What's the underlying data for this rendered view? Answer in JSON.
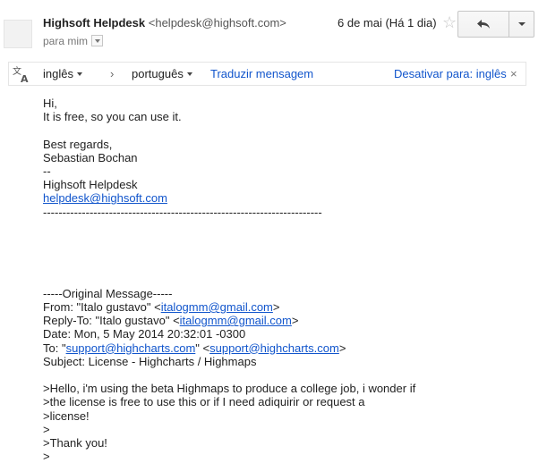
{
  "header": {
    "sender_name": "Highsoft Helpdesk",
    "sender_email": "<helpdesk@highsoft.com>",
    "recipient_label": "para mim",
    "date": "6 de mai (Há 1 dia)"
  },
  "translate_bar": {
    "source_language": "inglês",
    "arrow": "›",
    "target_language": "português",
    "translate_link": "Traduzir mensagem",
    "disable_link": "Desativar para: inglês",
    "close": "×"
  },
  "body": {
    "greeting": "Hi,",
    "line_free": "It is free, so you can use it.",
    "best_regards": "Best regards,",
    "signature_name": "Sebastian Bochan",
    "sig_separator": "--",
    "company": "Highsoft Helpdesk",
    "company_email": "helpdesk@highsoft.com",
    "dashed_rule": "------------------------------------------------------------------------",
    "original_header": "-----Original Message-----",
    "from_prefix": "From: \"Italo gustavo\" <",
    "from_email": "italogmm@gmail.com",
    "from_suffix": ">",
    "replyto_prefix": "Reply-To: \"Italo gustavo\" <",
    "replyto_email": "italogmm@gmail.com",
    "replyto_suffix": ">",
    "date_line": "Date: Mon, 5 May 2014 20:32:01 -0300",
    "to_prefix": "To: \"",
    "to_name_email": "support@highcharts.com",
    "to_middle": "\" <",
    "to_email": "support@highcharts.com",
    "to_suffix": ">",
    "subject_line": "Subject: License - Highcharts / Highmaps",
    "quote1": ">Hello, i'm using the beta Highmaps to produce a college job, i wonder if",
    "quote2": ">the license is free to use this or if I need adiquirir or request a",
    "quote3": ">license!",
    "quote4": ">",
    "quote5": ">Thank you!",
    "quote6": ">"
  }
}
